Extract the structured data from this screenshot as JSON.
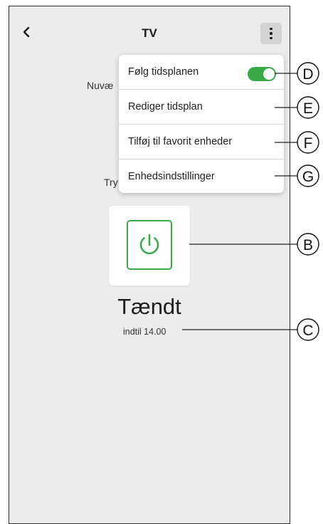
{
  "header": {
    "title": "TV",
    "back_icon": "chevron-left-icon",
    "more_icon": "kebab-menu-icon"
  },
  "background": {
    "current_label_partial": "Nuvæ",
    "try_label_partial": "Try"
  },
  "menu": {
    "items": [
      {
        "label": "Følg tidsplanen",
        "toggle_on": true
      },
      {
        "label": "Rediger tidsplan"
      },
      {
        "label": "Tilføj til favorit enheder"
      },
      {
        "label": "Enhedsindstillinger"
      }
    ]
  },
  "device": {
    "power_icon": "power-icon",
    "state": "Tændt",
    "until": "indtil 14.00"
  },
  "callouts": {
    "D": "D",
    "E": "E",
    "F": "F",
    "G": "G",
    "B": "B",
    "C": "C"
  },
  "colors": {
    "accent": "#3aaa47",
    "background": "#ececec",
    "menu_bg": "#ffffff",
    "kebab_bg": "#d3d3d3"
  }
}
